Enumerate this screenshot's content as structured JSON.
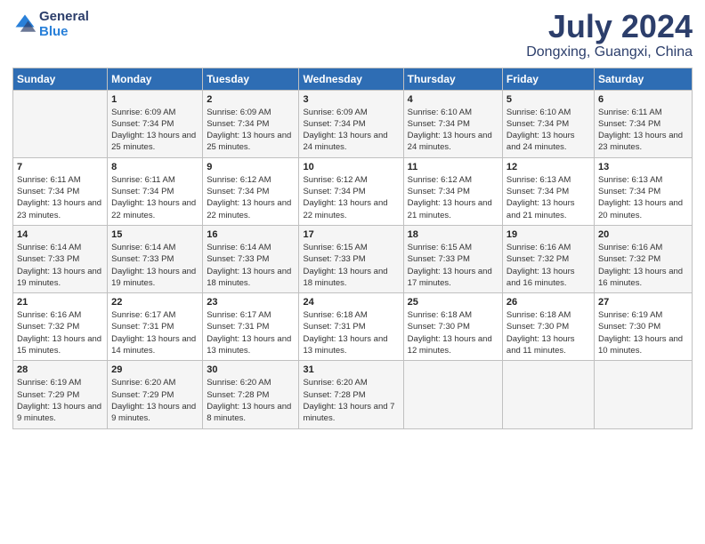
{
  "logo": {
    "line1": "General",
    "line2": "Blue"
  },
  "title": "July 2024",
  "subtitle": "Dongxing, Guangxi, China",
  "days_of_week": [
    "Sunday",
    "Monday",
    "Tuesday",
    "Wednesday",
    "Thursday",
    "Friday",
    "Saturday"
  ],
  "weeks": [
    [
      {
        "day": "",
        "sunrise": "",
        "sunset": "",
        "daylight": ""
      },
      {
        "day": "1",
        "sunrise": "Sunrise: 6:09 AM",
        "sunset": "Sunset: 7:34 PM",
        "daylight": "Daylight: 13 hours and 25 minutes."
      },
      {
        "day": "2",
        "sunrise": "Sunrise: 6:09 AM",
        "sunset": "Sunset: 7:34 PM",
        "daylight": "Daylight: 13 hours and 25 minutes."
      },
      {
        "day": "3",
        "sunrise": "Sunrise: 6:09 AM",
        "sunset": "Sunset: 7:34 PM",
        "daylight": "Daylight: 13 hours and 24 minutes."
      },
      {
        "day": "4",
        "sunrise": "Sunrise: 6:10 AM",
        "sunset": "Sunset: 7:34 PM",
        "daylight": "Daylight: 13 hours and 24 minutes."
      },
      {
        "day": "5",
        "sunrise": "Sunrise: 6:10 AM",
        "sunset": "Sunset: 7:34 PM",
        "daylight": "Daylight: 13 hours and 24 minutes."
      },
      {
        "day": "6",
        "sunrise": "Sunrise: 6:11 AM",
        "sunset": "Sunset: 7:34 PM",
        "daylight": "Daylight: 13 hours and 23 minutes."
      }
    ],
    [
      {
        "day": "7",
        "sunrise": "Sunrise: 6:11 AM",
        "sunset": "Sunset: 7:34 PM",
        "daylight": "Daylight: 13 hours and 23 minutes."
      },
      {
        "day": "8",
        "sunrise": "Sunrise: 6:11 AM",
        "sunset": "Sunset: 7:34 PM",
        "daylight": "Daylight: 13 hours and 22 minutes."
      },
      {
        "day": "9",
        "sunrise": "Sunrise: 6:12 AM",
        "sunset": "Sunset: 7:34 PM",
        "daylight": "Daylight: 13 hours and 22 minutes."
      },
      {
        "day": "10",
        "sunrise": "Sunrise: 6:12 AM",
        "sunset": "Sunset: 7:34 PM",
        "daylight": "Daylight: 13 hours and 22 minutes."
      },
      {
        "day": "11",
        "sunrise": "Sunrise: 6:12 AM",
        "sunset": "Sunset: 7:34 PM",
        "daylight": "Daylight: 13 hours and 21 minutes."
      },
      {
        "day": "12",
        "sunrise": "Sunrise: 6:13 AM",
        "sunset": "Sunset: 7:34 PM",
        "daylight": "Daylight: 13 hours and 21 minutes."
      },
      {
        "day": "13",
        "sunrise": "Sunrise: 6:13 AM",
        "sunset": "Sunset: 7:34 PM",
        "daylight": "Daylight: 13 hours and 20 minutes."
      }
    ],
    [
      {
        "day": "14",
        "sunrise": "Sunrise: 6:14 AM",
        "sunset": "Sunset: 7:33 PM",
        "daylight": "Daylight: 13 hours and 19 minutes."
      },
      {
        "day": "15",
        "sunrise": "Sunrise: 6:14 AM",
        "sunset": "Sunset: 7:33 PM",
        "daylight": "Daylight: 13 hours and 19 minutes."
      },
      {
        "day": "16",
        "sunrise": "Sunrise: 6:14 AM",
        "sunset": "Sunset: 7:33 PM",
        "daylight": "Daylight: 13 hours and 18 minutes."
      },
      {
        "day": "17",
        "sunrise": "Sunrise: 6:15 AM",
        "sunset": "Sunset: 7:33 PM",
        "daylight": "Daylight: 13 hours and 18 minutes."
      },
      {
        "day": "18",
        "sunrise": "Sunrise: 6:15 AM",
        "sunset": "Sunset: 7:33 PM",
        "daylight": "Daylight: 13 hours and 17 minutes."
      },
      {
        "day": "19",
        "sunrise": "Sunrise: 6:16 AM",
        "sunset": "Sunset: 7:32 PM",
        "daylight": "Daylight: 13 hours and 16 minutes."
      },
      {
        "day": "20",
        "sunrise": "Sunrise: 6:16 AM",
        "sunset": "Sunset: 7:32 PM",
        "daylight": "Daylight: 13 hours and 16 minutes."
      }
    ],
    [
      {
        "day": "21",
        "sunrise": "Sunrise: 6:16 AM",
        "sunset": "Sunset: 7:32 PM",
        "daylight": "Daylight: 13 hours and 15 minutes."
      },
      {
        "day": "22",
        "sunrise": "Sunrise: 6:17 AM",
        "sunset": "Sunset: 7:31 PM",
        "daylight": "Daylight: 13 hours and 14 minutes."
      },
      {
        "day": "23",
        "sunrise": "Sunrise: 6:17 AM",
        "sunset": "Sunset: 7:31 PM",
        "daylight": "Daylight: 13 hours and 13 minutes."
      },
      {
        "day": "24",
        "sunrise": "Sunrise: 6:18 AM",
        "sunset": "Sunset: 7:31 PM",
        "daylight": "Daylight: 13 hours and 13 minutes."
      },
      {
        "day": "25",
        "sunrise": "Sunrise: 6:18 AM",
        "sunset": "Sunset: 7:30 PM",
        "daylight": "Daylight: 13 hours and 12 minutes."
      },
      {
        "day": "26",
        "sunrise": "Sunrise: 6:18 AM",
        "sunset": "Sunset: 7:30 PM",
        "daylight": "Daylight: 13 hours and 11 minutes."
      },
      {
        "day": "27",
        "sunrise": "Sunrise: 6:19 AM",
        "sunset": "Sunset: 7:30 PM",
        "daylight": "Daylight: 13 hours and 10 minutes."
      }
    ],
    [
      {
        "day": "28",
        "sunrise": "Sunrise: 6:19 AM",
        "sunset": "Sunset: 7:29 PM",
        "daylight": "Daylight: 13 hours and 9 minutes."
      },
      {
        "day": "29",
        "sunrise": "Sunrise: 6:20 AM",
        "sunset": "Sunset: 7:29 PM",
        "daylight": "Daylight: 13 hours and 9 minutes."
      },
      {
        "day": "30",
        "sunrise": "Sunrise: 6:20 AM",
        "sunset": "Sunset: 7:28 PM",
        "daylight": "Daylight: 13 hours and 8 minutes."
      },
      {
        "day": "31",
        "sunrise": "Sunrise: 6:20 AM",
        "sunset": "Sunset: 7:28 PM",
        "daylight": "Daylight: 13 hours and 7 minutes."
      },
      {
        "day": "",
        "sunrise": "",
        "sunset": "",
        "daylight": ""
      },
      {
        "day": "",
        "sunrise": "",
        "sunset": "",
        "daylight": ""
      },
      {
        "day": "",
        "sunrise": "",
        "sunset": "",
        "daylight": ""
      }
    ]
  ]
}
